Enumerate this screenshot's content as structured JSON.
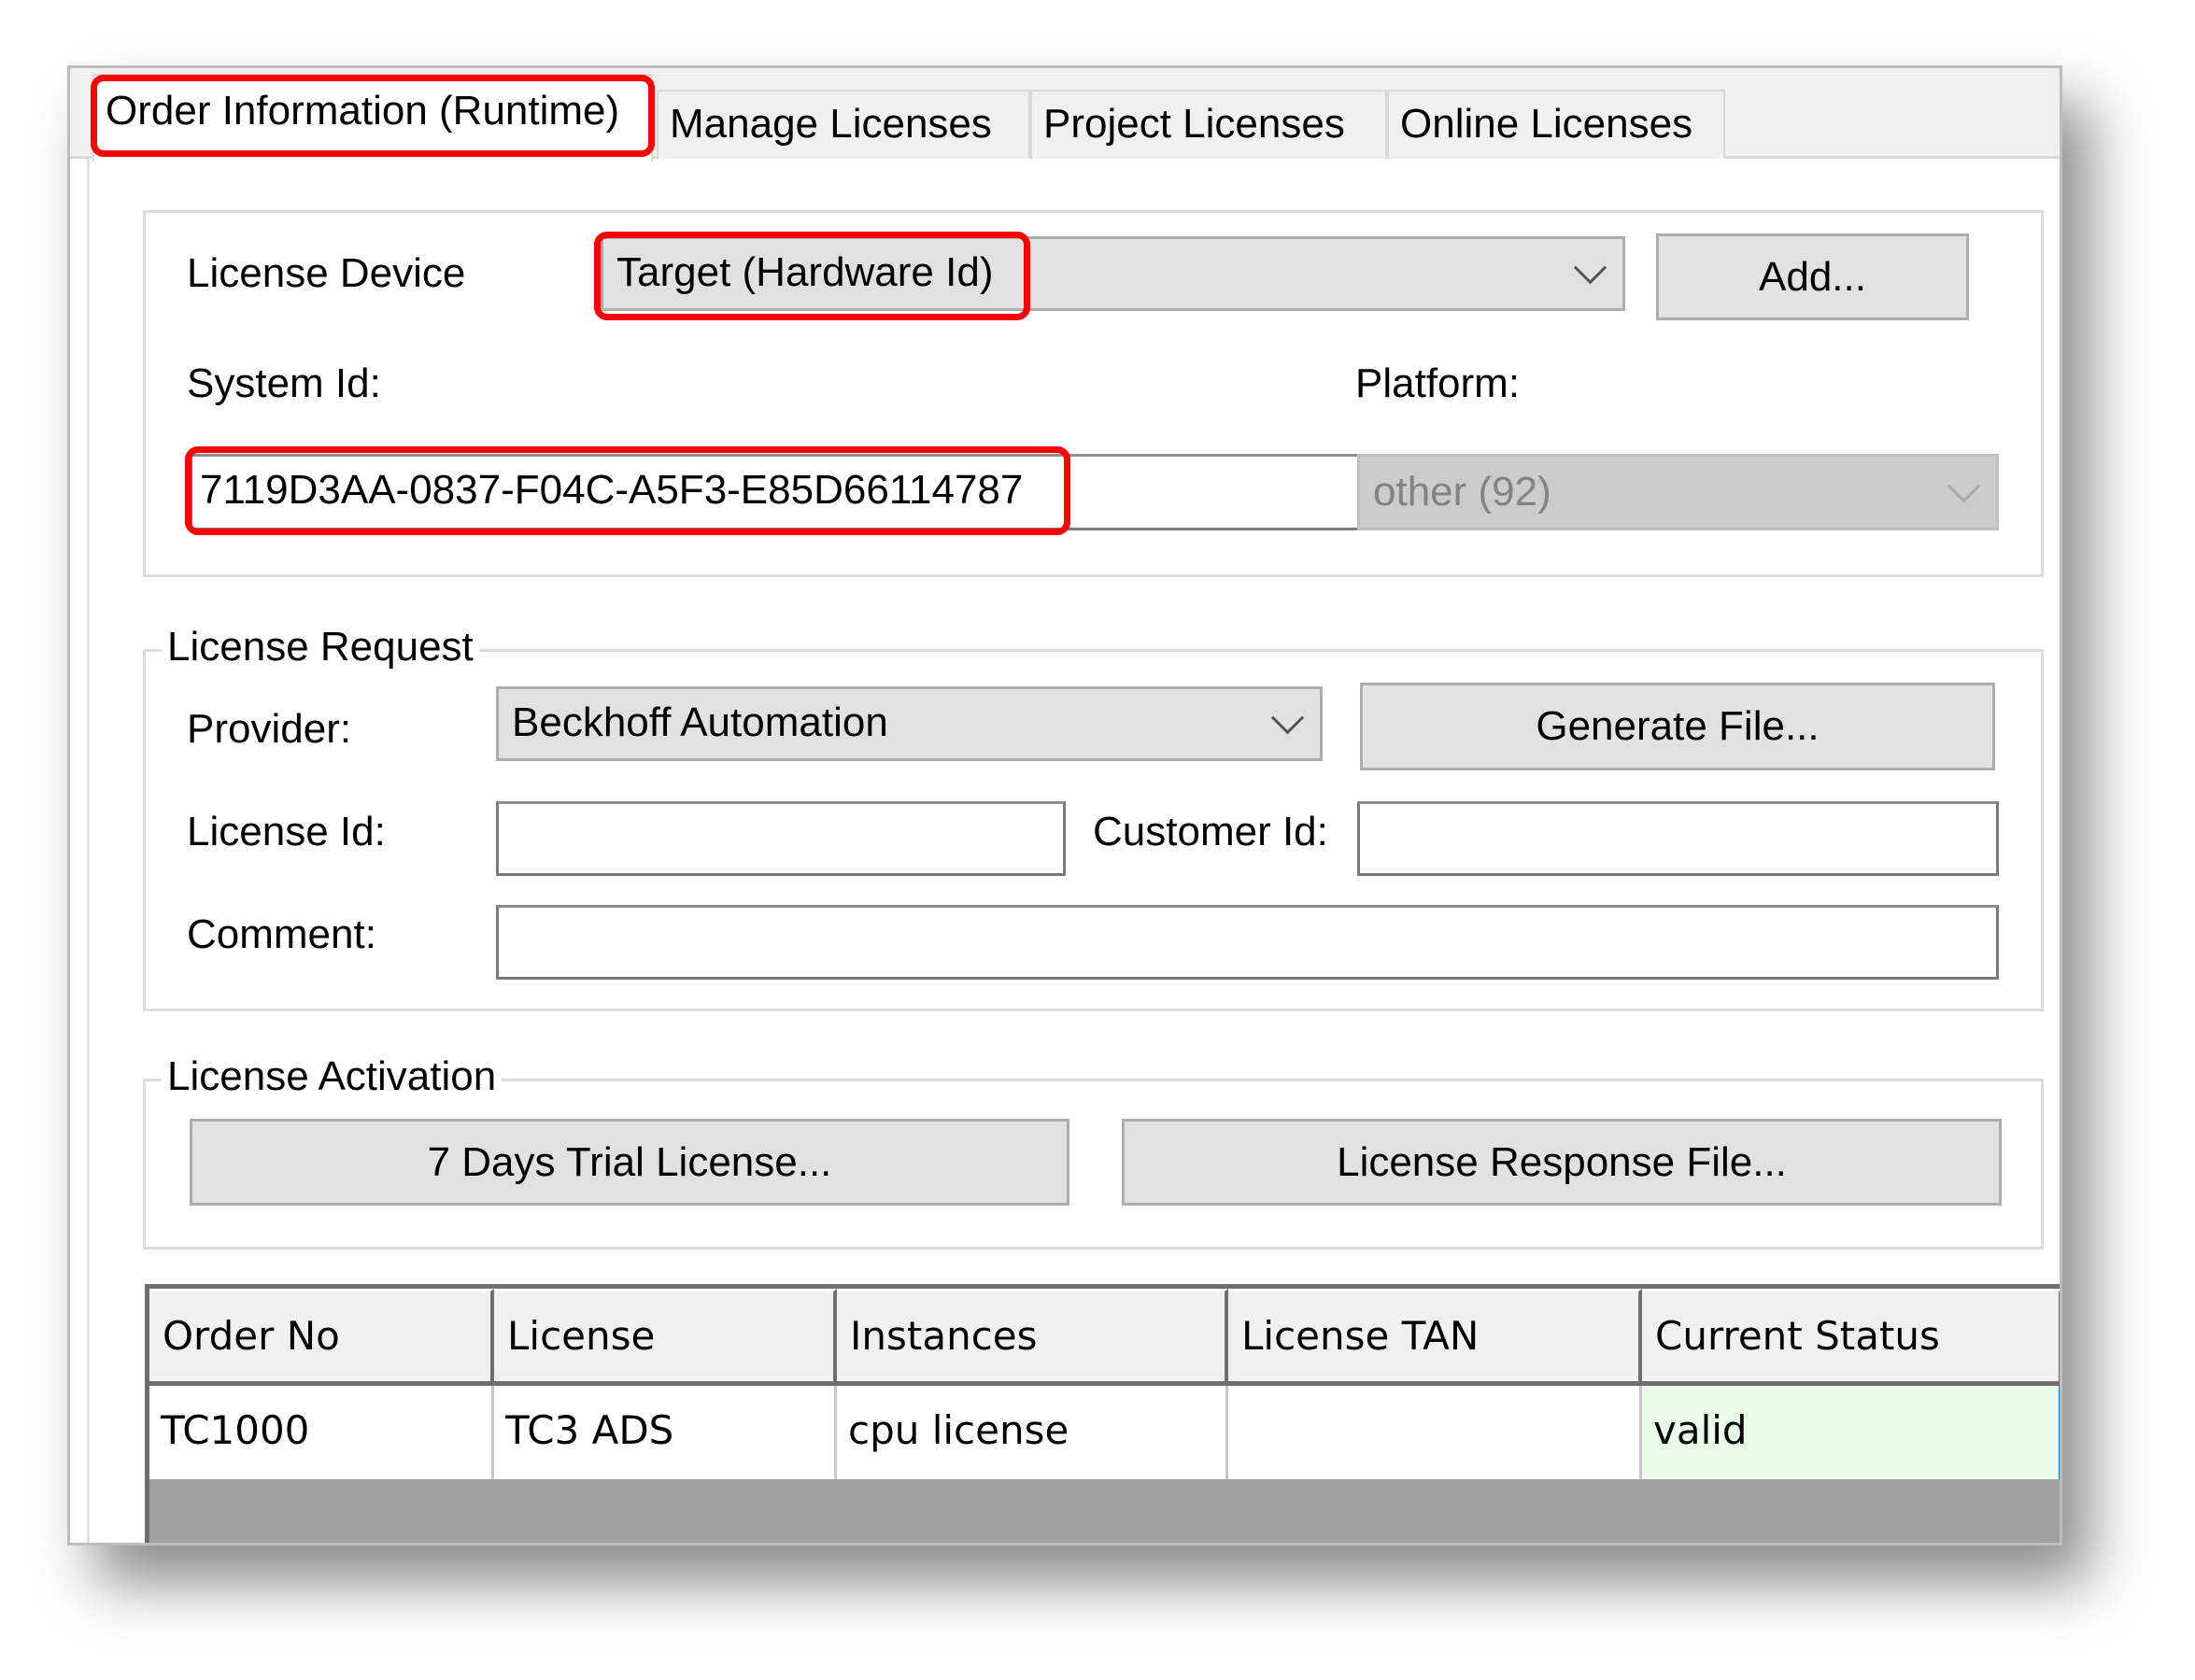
{
  "tabs": [
    {
      "label": "Order Information (Runtime)",
      "active": true
    },
    {
      "label": "Manage Licenses",
      "active": false
    },
    {
      "label": "Project Licenses",
      "active": false
    },
    {
      "label": "Online Licenses",
      "active": false
    }
  ],
  "device_group": {
    "license_device_label": "License Device",
    "license_device_value": "Target (Hardware Id)",
    "add_button": "Add...",
    "system_id_label": "System Id:",
    "system_id_value": "7119D3AA-0837-F04C-A5F3-E85D66114787",
    "platform_label": "Platform:",
    "platform_value": "other (92)"
  },
  "license_request": {
    "legend": "License Request",
    "provider_label": "Provider:",
    "provider_value": "Beckhoff Automation",
    "generate_button": "Generate File...",
    "license_id_label": "License Id:",
    "license_id_value": "",
    "customer_id_label": "Customer Id:",
    "customer_id_value": "",
    "comment_label": "Comment:",
    "comment_value": ""
  },
  "license_activation": {
    "legend": "License Activation",
    "trial_button": "7 Days Trial License...",
    "response_button": "License Response File..."
  },
  "table": {
    "columns": [
      "Order No",
      "License",
      "Instances",
      "License TAN",
      "Current Status"
    ],
    "rows": [
      {
        "order_no": "TC1000",
        "license": "TC3 ADS",
        "instances": "cpu license",
        "license_tan": "",
        "current_status": "valid"
      }
    ]
  },
  "colors": {
    "highlight": "#ff0000",
    "valid_status_bg": "#e8fce8"
  }
}
